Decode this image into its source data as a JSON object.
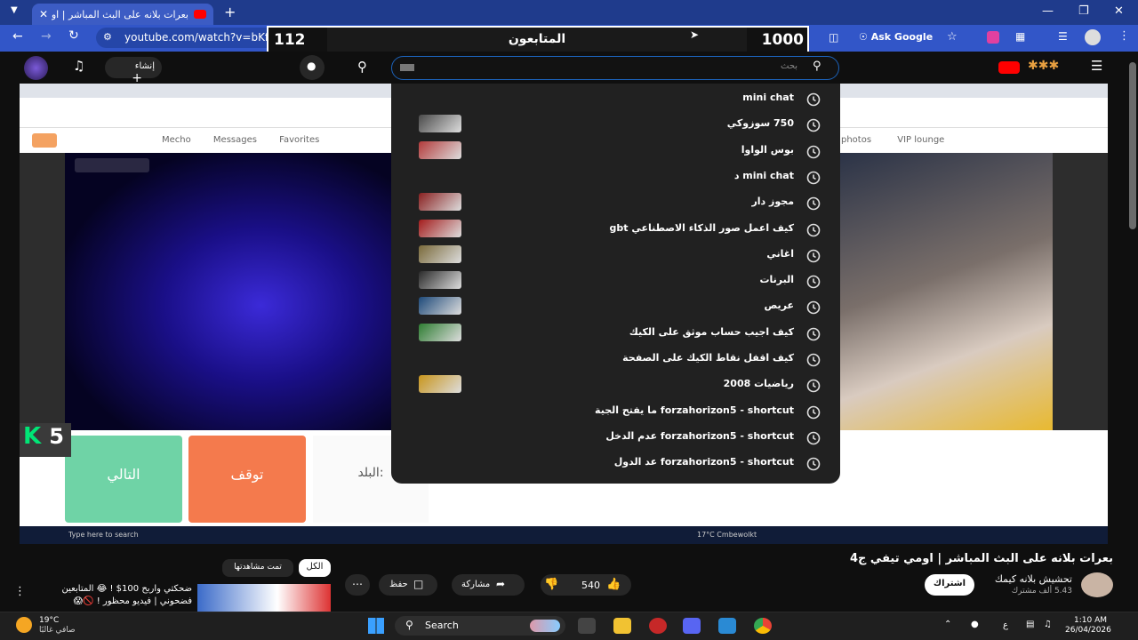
{
  "browser": {
    "tab_title": "بعرات بلانه على البث المباشر | او",
    "url": "youtube.com/watch?v=bKf8l",
    "ask_google": "Ask Google"
  },
  "overlay": {
    "left_count": "112",
    "followers_label": "المتابعون",
    "right_count": "1000"
  },
  "youtube_header": {
    "create_label": "إنشاء",
    "search_placeholder": "بحث"
  },
  "search_suggestions": [
    {
      "label": "mini chat",
      "thumb": false
    },
    {
      "label": "750 سوزوكي",
      "thumb": true,
      "thumb_color": "#4a4a4a"
    },
    {
      "label": "بوس الواوا",
      "thumb": true,
      "thumb_color": "#b33a3a"
    },
    {
      "label": "mini chat د",
      "thumb": false
    },
    {
      "label": "مجوز دار",
      "thumb": true,
      "thumb_color": "#8a2020"
    },
    {
      "label": "كيف اعمل صور الذكاء الاصطناعي gbt",
      "thumb": true,
      "thumb_color": "#a41c1c"
    },
    {
      "label": "اغاني",
      "thumb": true,
      "thumb_color": "#7a6a3a"
    },
    {
      "label": "البرنات",
      "thumb": true,
      "thumb_color": "#2a2a2a"
    },
    {
      "label": "عريص",
      "thumb": true,
      "thumb_color": "#1e4a7a"
    },
    {
      "label": "كيف اجيب حساب موثق على الكيك",
      "thumb": true,
      "thumb_color": "#2e7d32"
    },
    {
      "label": "كيف اقفل نقاط الكيك على الصفحة",
      "thumb": false
    },
    {
      "label": "رياضيات 2008",
      "thumb": true,
      "thumb_color": "#c8951c"
    },
    {
      "label": "forzahorizon5 - shortcut ما يفتح الجية",
      "thumb": false
    },
    {
      "label": "forzahorizon5 - shortcut عدم الدخل",
      "thumb": false
    },
    {
      "label": "forzahorizon5 - shortcut عد الدول",
      "thumb": false
    }
  ],
  "inner_app": {
    "next_label": "التالي",
    "stop_label": "توقف",
    "country_label": "البلد:",
    "k_badge": "K",
    "k_number": "5",
    "nav_items": [
      "Mecho",
      "Messages",
      "Favorites"
    ],
    "right_nav": [
      "photos",
      "VIP lounge"
    ],
    "taskbar_search": "Type here to search",
    "taskbar_weather": "17°C Cmbewolkt"
  },
  "video_info": {
    "title": "بعرات بلانه على البث المباشر | اومي تيفي ج4",
    "channel_name": "تحشيش بلانه كيمك",
    "subscribers": "5.43 ألف مشترك",
    "subscribe_label": "اشتراك",
    "likes": "540",
    "share_label": "مشاركة",
    "save_label": "حفظ"
  },
  "sidebar_filters": {
    "all": "الكل",
    "watched": "تمت مشاهدتها"
  },
  "recommended": {
    "title_line1": "ضحكتي واربح 100$ ! 😂 المتابعين",
    "title_line2": "فضحوني | فيديو محظور ! 🚫😱"
  },
  "taskbar": {
    "search_label": "Search",
    "weather_temp": "19°C",
    "weather_desc": "صافي غالبًا",
    "time": "1:10 AM",
    "date": "26/04/2026",
    "lang": "ع"
  },
  "colors": {
    "youtube_red": "#ff0000",
    "browser_blue": "#3256c8",
    "next_green": "#6fd3a6",
    "stop_orange": "#f47a4d"
  }
}
